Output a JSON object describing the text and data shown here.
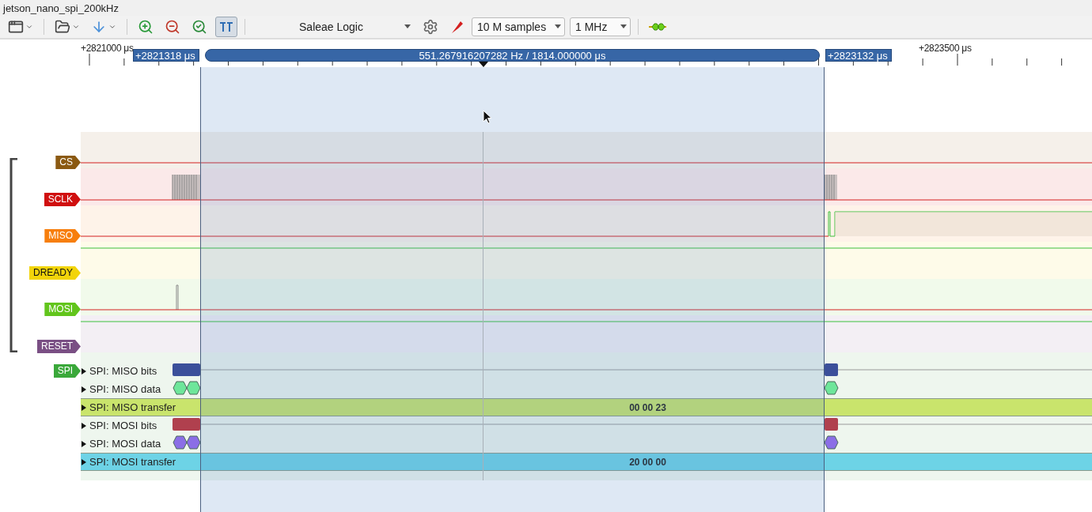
{
  "window": {
    "title": "jetson_nano_spi_200kHz"
  },
  "toolbar": {
    "snap_toggle": {
      "selected": true
    },
    "device": "Saleae Logic",
    "samples": "10 M samples",
    "rate": "1 MHz"
  },
  "ruler": {
    "labels": [
      "+2821000 μs",
      "+2823500 μs"
    ],
    "start_marker": "+2821318 μs",
    "measurement": "551.267916207282 Hz / 1814.000000 μs",
    "end_marker": "+2823132 μs"
  },
  "channels": [
    {
      "name": "CS",
      "color": "#8b5a12"
    },
    {
      "name": "SCLK",
      "color": "#d00f0f"
    },
    {
      "name": "MISO",
      "color": "#f77e0c"
    },
    {
      "name": "DREADY",
      "color": "#f2d40a"
    },
    {
      "name": "MOSI",
      "color": "#62c51c"
    },
    {
      "name": "RESET",
      "color": "#7a4f84"
    }
  ],
  "analyzer": {
    "name": "SPI",
    "color": "#3aa83a",
    "rows": [
      {
        "label": "SPI: MISO bits",
        "kind": "bits",
        "color": "#3b4f9a",
        "expanded": false
      },
      {
        "label": "SPI: MISO data",
        "kind": "data",
        "color": "#6ee69a",
        "expanded": false
      },
      {
        "label": "SPI: MISO transfer",
        "kind": "transfer",
        "color": "#c9e46c",
        "value": "00 00 23",
        "expanded": false
      },
      {
        "label": "SPI: MOSI bits",
        "kind": "bits",
        "color": "#b0404e",
        "expanded": false
      },
      {
        "label": "SPI: MOSI data",
        "kind": "data",
        "color": "#8b6ee6",
        "expanded": false
      },
      {
        "label": "SPI: MOSI transfer",
        "kind": "transfer",
        "color": "#6dd3e6",
        "value": "20 00 00",
        "expanded": false
      }
    ]
  }
}
